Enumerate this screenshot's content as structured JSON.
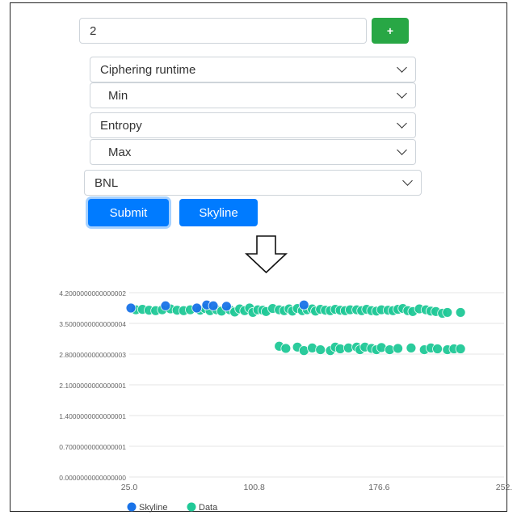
{
  "form": {
    "number_value": "2",
    "add_label": "+",
    "selects": [
      {
        "value": "Ciphering runtime"
      },
      {
        "value": "Min"
      },
      {
        "value": "Entropy"
      },
      {
        "value": "Max"
      },
      {
        "value": "BNL"
      }
    ],
    "submit_label": "Submit",
    "skyline_label": "Skyline"
  },
  "icons": {
    "down_arrow": "down-arrow-icon",
    "chevron": "chevron-down-icon"
  },
  "chart_data": {
    "type": "scatter",
    "xlim": [
      25.0,
      252.4
    ],
    "x_ticks": [
      "25.0",
      "100.8",
      "176.6",
      "252."
    ],
    "ylim": [
      0,
      0.042
    ],
    "y_ticks": [
      {
        "v": 0.042,
        "label": "4.2000000000000002"
      },
      {
        "v": 0.035,
        "label": "3.5000000000000004"
      },
      {
        "v": 0.028,
        "label": "2.8000000000000003"
      },
      {
        "v": 0.021,
        "label": "2.1000000000000001"
      },
      {
        "v": 0.014,
        "label": "1.4000000000000001"
      },
      {
        "v": 0.007,
        "label": "0.7000000000000001"
      },
      {
        "v": 0.0,
        "label": "0.0000000000000000"
      }
    ],
    "series": [
      {
        "name": "Skyline",
        "color": "#1a73e8",
        "points": [
          [
            26,
            0.0385
          ],
          [
            47,
            0.039
          ],
          [
            66,
            0.0385
          ],
          [
            72,
            0.0392
          ],
          [
            76,
            0.039
          ],
          [
            84,
            0.0389
          ],
          [
            131,
            0.0392
          ]
        ]
      },
      {
        "name": "Data",
        "color": "#20c997",
        "points": [
          [
            29,
            0.0381
          ],
          [
            33,
            0.0382
          ],
          [
            37,
            0.038
          ],
          [
            41,
            0.0379
          ],
          [
            45,
            0.0381
          ],
          [
            50,
            0.0383
          ],
          [
            54,
            0.038
          ],
          [
            58,
            0.0379
          ],
          [
            62,
            0.0381
          ],
          [
            68,
            0.038
          ],
          [
            71,
            0.0384
          ],
          [
            74,
            0.0379
          ],
          [
            78,
            0.0381
          ],
          [
            81,
            0.0378
          ],
          [
            86,
            0.0381
          ],
          [
            89,
            0.0376
          ],
          [
            92,
            0.0383
          ],
          [
            95,
            0.0379
          ],
          [
            98,
            0.0385
          ],
          [
            100,
            0.0375
          ],
          [
            103,
            0.0381
          ],
          [
            106,
            0.038
          ],
          [
            108,
            0.0377
          ],
          [
            112,
            0.0384
          ],
          [
            116,
            0.0381
          ],
          [
            119,
            0.0379
          ],
          [
            122,
            0.0383
          ],
          [
            124,
            0.0378
          ],
          [
            127,
            0.0384
          ],
          [
            130,
            0.0379
          ],
          [
            133,
            0.0381
          ],
          [
            136,
            0.0383
          ],
          [
            138,
            0.0378
          ],
          [
            141,
            0.0382
          ],
          [
            144,
            0.038
          ],
          [
            147,
            0.0379
          ],
          [
            150,
            0.0382
          ],
          [
            153,
            0.038
          ],
          [
            156,
            0.0379
          ],
          [
            159,
            0.0381
          ],
          [
            163,
            0.0381
          ],
          [
            166,
            0.0379
          ],
          [
            169,
            0.0382
          ],
          [
            172,
            0.0379
          ],
          [
            175,
            0.0378
          ],
          [
            178,
            0.0381
          ],
          [
            182,
            0.038
          ],
          [
            185,
            0.0379
          ],
          [
            188,
            0.0382
          ],
          [
            191,
            0.0384
          ],
          [
            194,
            0.0379
          ],
          [
            197,
            0.0377
          ],
          [
            201,
            0.0383
          ],
          [
            205,
            0.0381
          ],
          [
            208,
            0.0378
          ],
          [
            211,
            0.0377
          ],
          [
            215,
            0.0373
          ],
          [
            218,
            0.0375
          ],
          [
            226,
            0.0375
          ],
          [
            116,
            0.0298
          ],
          [
            120,
            0.0293
          ],
          [
            127,
            0.0296
          ],
          [
            131,
            0.0288
          ],
          [
            136,
            0.0294
          ],
          [
            141,
            0.029
          ],
          [
            147,
            0.0288
          ],
          [
            150,
            0.0296
          ],
          [
            153,
            0.0292
          ],
          [
            158,
            0.0294
          ],
          [
            163,
            0.0296
          ],
          [
            165,
            0.029
          ],
          [
            168,
            0.0296
          ],
          [
            172,
            0.0293
          ],
          [
            175,
            0.029
          ],
          [
            178,
            0.0295
          ],
          [
            183,
            0.029
          ],
          [
            188,
            0.0293
          ],
          [
            196,
            0.0294
          ],
          [
            204,
            0.029
          ],
          [
            208,
            0.0294
          ],
          [
            212,
            0.0292
          ],
          [
            218,
            0.029
          ],
          [
            222,
            0.0292
          ],
          [
            226,
            0.0292
          ]
        ]
      }
    ]
  }
}
